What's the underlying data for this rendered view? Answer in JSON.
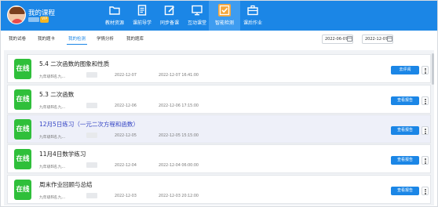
{
  "header": {
    "app_title": "我的课程",
    "level_badge": "VIP",
    "nav": [
      {
        "label": "教材资源",
        "icon": "folder-icon",
        "active": false
      },
      {
        "label": "课前导学",
        "icon": "document-icon",
        "active": false
      },
      {
        "label": "同步备课",
        "icon": "edit-icon",
        "active": false
      },
      {
        "label": "互动课堂",
        "icon": "monitor-icon",
        "active": false
      },
      {
        "label": "智能检测",
        "icon": "check-box-icon",
        "active": true
      },
      {
        "label": "课后作业",
        "icon": "briefcase-icon",
        "active": false
      }
    ]
  },
  "subnav": {
    "items": [
      "我的试卷",
      "我的题卡",
      "我的检测",
      "学情分析",
      "我的题库"
    ],
    "active_index": 2,
    "date_start": "2022-06-07",
    "date_end": "2022-12-07"
  },
  "list": [
    {
      "badge": "在线",
      "title": "5.4 二次函数的图象和性质",
      "class_name": "九年级8班,九...",
      "start": "2022-12-07",
      "end": "2022-12-07 16:41:00",
      "action": "去评阅",
      "highlight": false
    },
    {
      "badge": "在线",
      "title": "5.3 二次函数",
      "class_name": "九年级8班,九...",
      "start": "2022-12-06",
      "end": "2022-12-06 17:15:00",
      "action": "查看报告",
      "highlight": false
    },
    {
      "badge": "在线",
      "title": "12月5日练习（一元二次方程和函数）",
      "class_name": "九年级8班,九...",
      "start": "2022-12-05",
      "end": "2022-12-05 15:15:00",
      "action": "查看报告",
      "highlight": true
    },
    {
      "badge": "在线",
      "title": "11月4日数学练习",
      "class_name": "九年级8班,九...",
      "start": "2022-12-04",
      "end": "2022-12-04 06:00:00",
      "action": "查看报告",
      "highlight": false
    },
    {
      "badge": "在线",
      "title": "周末作业回顾与总结",
      "class_name": "九年级8班,九...",
      "start": "2022-12-03",
      "end": "2022-12-03 20:12:00",
      "action": "查看报告",
      "highlight": false
    }
  ],
  "colors": {
    "primary": "#1b86e6",
    "online": "#2fbf3a",
    "active_nav": "#f7a73b"
  }
}
